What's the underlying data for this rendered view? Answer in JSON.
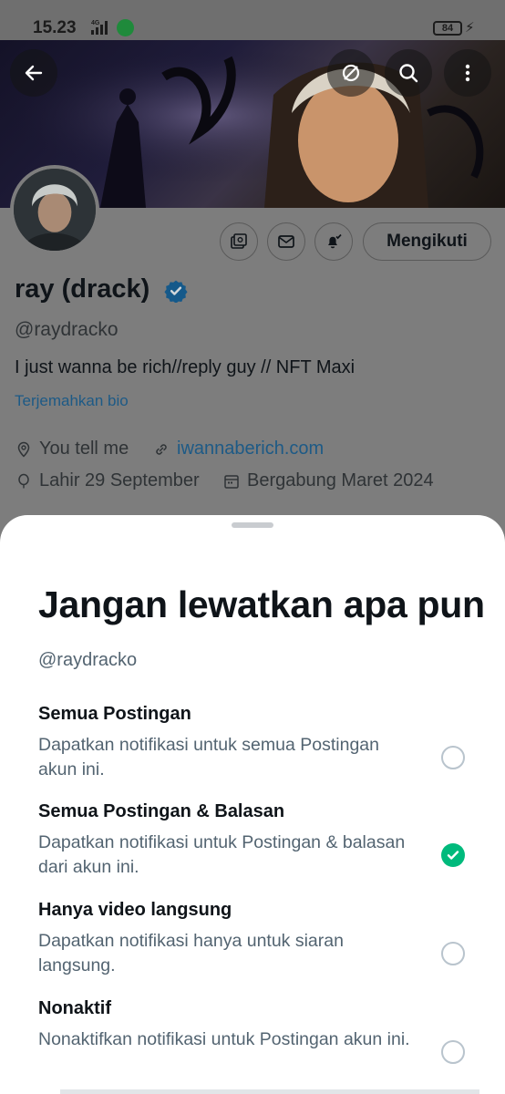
{
  "status_bar": {
    "time": "15.23",
    "network": "4G",
    "battery": "84"
  },
  "profile": {
    "name": "ray (drack)",
    "handle": "@raydracko",
    "bio": "I just wanna be rich//reply guy // NFT Maxi",
    "translate_bio": "Terjemahkan bio",
    "location": "You tell me",
    "website": "iwannaberich.com",
    "birthday": "Lahir 29 September",
    "joined": "Bergabung Maret 2024",
    "follow_button": "Mengikuti"
  },
  "sheet": {
    "title": "Jangan lewatkan apa pun",
    "handle": "@raydracko",
    "options": [
      {
        "title": "Semua Postingan",
        "description": "Dapatkan notifikasi untuk semua Postingan akun ini.",
        "selected": false
      },
      {
        "title": "Semua Postingan & Balasan",
        "description": "Dapatkan notifikasi untuk Postingan & balasan dari akun ini.",
        "selected": true
      },
      {
        "title": "Hanya video langsung",
        "description": "Dapatkan notifikasi hanya untuk siaran langsung.",
        "selected": false
      },
      {
        "title": "Nonaktif",
        "description": "Nonaktifkan notifikasi untuk Postingan akun ini.",
        "selected": false
      }
    ]
  },
  "colors": {
    "accent_green": "#00ba7c",
    "link_blue": "#1d9bf0",
    "scrim_gray": "#7d7d7d"
  }
}
